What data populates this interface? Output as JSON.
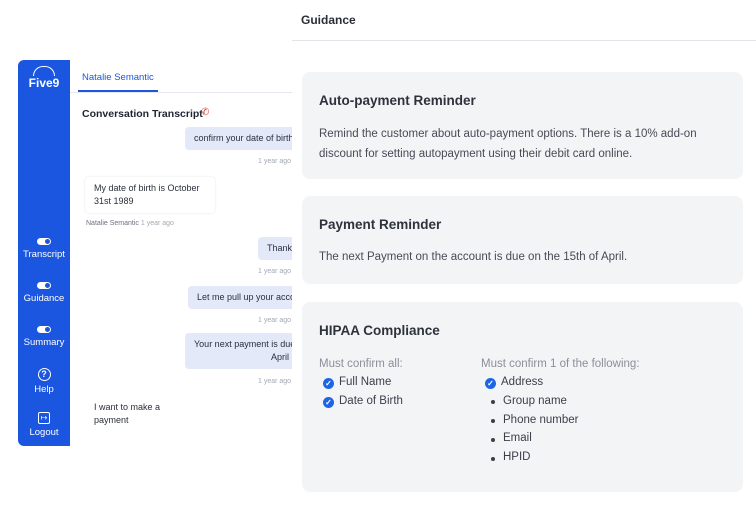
{
  "app": {
    "logo_text": "Five9",
    "agent_tab": "Natalie Semantic",
    "conversation_title": "Conversation Transcript",
    "rail": [
      {
        "label": "Transcript"
      },
      {
        "label": "Guidance"
      },
      {
        "label": "Summary"
      },
      {
        "label": "Help"
      },
      {
        "label": "Logout"
      }
    ],
    "messages": {
      "m1": "confirm your date of birth",
      "m1_ts": "1 year ago",
      "m2": "My date of birth is October 31st 1989",
      "m2_sender": "Natalie Semantic",
      "m2_ts": "1 year ago",
      "m3": "Thank you",
      "m3_ts": "1 year ago",
      "m4": "Let me pull up your account",
      "m4_ts": "1 year ago",
      "m5_line1": "Your next payment is due",
      "m5_line2": "April",
      "m5_ts": "1 year ago",
      "m6": "I want to make a payment"
    },
    "accent_color": "#1a56e0"
  },
  "guidance": {
    "title": "Guidance",
    "cards": {
      "autopay": {
        "title": "Auto-payment Reminder",
        "text": "Remind the customer about auto-payment options. There is a 10% add-on discount for setting autopayment using their debit card online."
      },
      "payment": {
        "title": "Payment Reminder",
        "text": "The next Payment on the account is due on the 15th of April."
      },
      "hipaa": {
        "title": "HIPAA Compliance",
        "must_all_label": "Must confirm all:",
        "must_all": [
          "Full Name",
          "Date of Birth"
        ],
        "must_one_label": "Must confirm 1 of the following:",
        "must_one_checked": "Address",
        "must_one": [
          "Group name",
          "Phone number",
          "Email",
          "HPID"
        ]
      }
    },
    "check_color": "#1e64e6"
  }
}
